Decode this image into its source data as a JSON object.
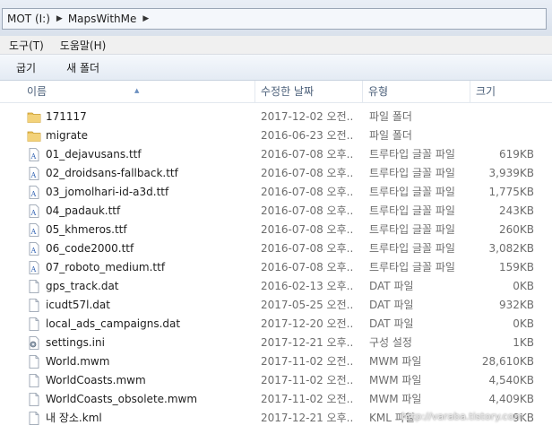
{
  "address_bar": {
    "crumbs": [
      "MOT (I:)",
      "MapsWithMe"
    ]
  },
  "menu": {
    "items": [
      "도구(T)",
      "도움말(H)"
    ]
  },
  "toolbar": {
    "share_label": "굽기",
    "new_folder_label": "새 폴더"
  },
  "columns": {
    "name": "이름",
    "date": "수정한 날짜",
    "type": "유형",
    "size": "크기"
  },
  "files": [
    {
      "name": "171117",
      "date": "2017-12-02 오전...",
      "type": "파일 폴더",
      "size": "",
      "icon": "folder-icon"
    },
    {
      "name": "migrate",
      "date": "2016-06-23 오전...",
      "type": "파일 폴더",
      "size": "",
      "icon": "folder-icon"
    },
    {
      "name": "01_dejavusans.ttf",
      "date": "2016-07-08 오후...",
      "type": "트루타입 글꼴 파일",
      "size": "619KB",
      "icon": "font-file-icon"
    },
    {
      "name": "02_droidsans-fallback.ttf",
      "date": "2016-07-08 오후...",
      "type": "트루타입 글꼴 파일",
      "size": "3,939KB",
      "icon": "font-file-icon"
    },
    {
      "name": "03_jomolhari-id-a3d.ttf",
      "date": "2016-07-08 오후...",
      "type": "트루타입 글꼴 파일",
      "size": "1,775KB",
      "icon": "font-file-icon"
    },
    {
      "name": "04_padauk.ttf",
      "date": "2016-07-08 오후...",
      "type": "트루타입 글꼴 파일",
      "size": "243KB",
      "icon": "font-file-icon"
    },
    {
      "name": "05_khmeros.ttf",
      "date": "2016-07-08 오후...",
      "type": "트루타입 글꼴 파일",
      "size": "260KB",
      "icon": "font-file-icon"
    },
    {
      "name": "06_code2000.ttf",
      "date": "2016-07-08 오후...",
      "type": "트루타입 글꼴 파일",
      "size": "3,082KB",
      "icon": "font-file-icon"
    },
    {
      "name": "07_roboto_medium.ttf",
      "date": "2016-07-08 오후...",
      "type": "트루타입 글꼴 파일",
      "size": "159KB",
      "icon": "font-file-icon"
    },
    {
      "name": "gps_track.dat",
      "date": "2016-02-13 오후...",
      "type": "DAT 파일",
      "size": "0KB",
      "icon": "document-icon"
    },
    {
      "name": "icudt57l.dat",
      "date": "2017-05-25 오전...",
      "type": "DAT 파일",
      "size": "932KB",
      "icon": "document-icon"
    },
    {
      "name": "local_ads_campaigns.dat",
      "date": "2017-12-20 오전...",
      "type": "DAT 파일",
      "size": "0KB",
      "icon": "document-icon"
    },
    {
      "name": "settings.ini",
      "date": "2017-12-21 오후...",
      "type": "구성 설정",
      "size": "1KB",
      "icon": "settings-file-icon"
    },
    {
      "name": "World.mwm",
      "date": "2017-11-02 오전...",
      "type": "MWM 파일",
      "size": "28,610KB",
      "icon": "blank-file-icon"
    },
    {
      "name": "WorldCoasts.mwm",
      "date": "2017-11-02 오전...",
      "type": "MWM 파일",
      "size": "4,540KB",
      "icon": "blank-file-icon"
    },
    {
      "name": "WorldCoasts_obsolete.mwm",
      "date": "2017-11-02 오전...",
      "type": "MWM 파일",
      "size": "4,409KB",
      "icon": "blank-file-icon"
    },
    {
      "name": "내 장소.kml",
      "date": "2017-12-21 오후...",
      "type": "KML 파일",
      "size": "9KB",
      "icon": "blank-file-icon"
    }
  ],
  "watermark": "http://varaba.tistory.com"
}
